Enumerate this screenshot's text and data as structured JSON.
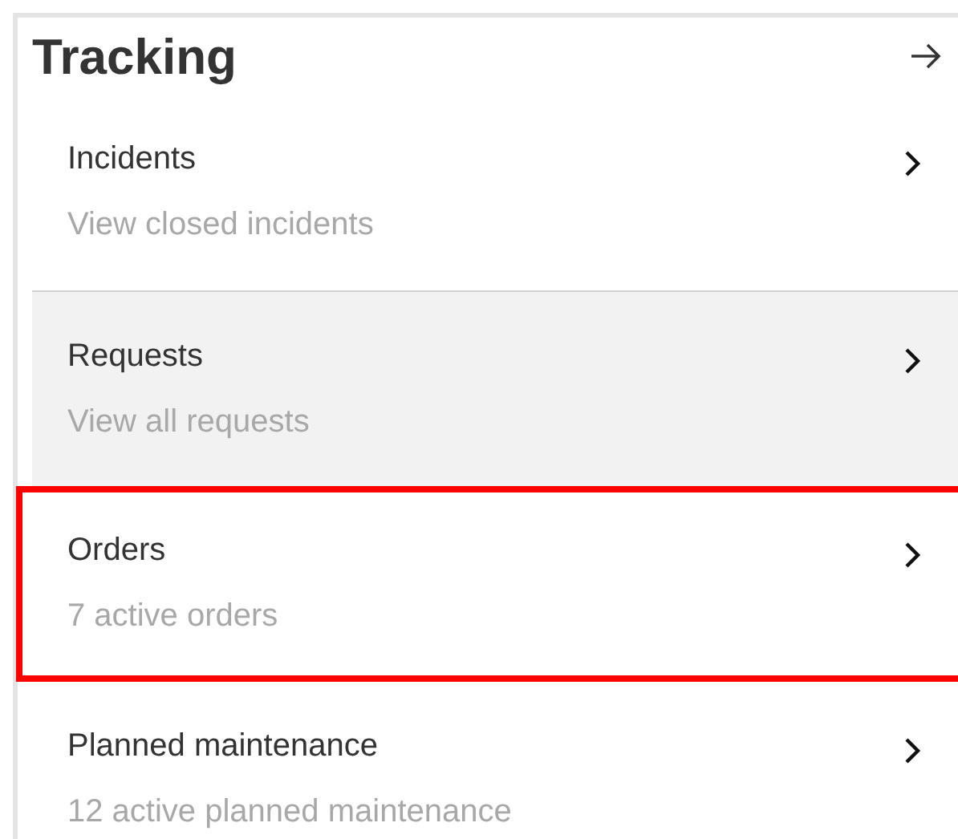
{
  "header": {
    "title": "Tracking"
  },
  "items": [
    {
      "title": "Incidents",
      "subtitle": "View closed incidents",
      "hovered": false,
      "highlighted": false
    },
    {
      "title": "Requests",
      "subtitle": "View all requests",
      "hovered": true,
      "highlighted": false
    },
    {
      "title": "Orders",
      "subtitle": "7 active orders",
      "hovered": false,
      "highlighted": true
    },
    {
      "title": "Planned maintenance",
      "subtitle": "12 active planned maintenance",
      "hovered": false,
      "highlighted": false
    }
  ]
}
